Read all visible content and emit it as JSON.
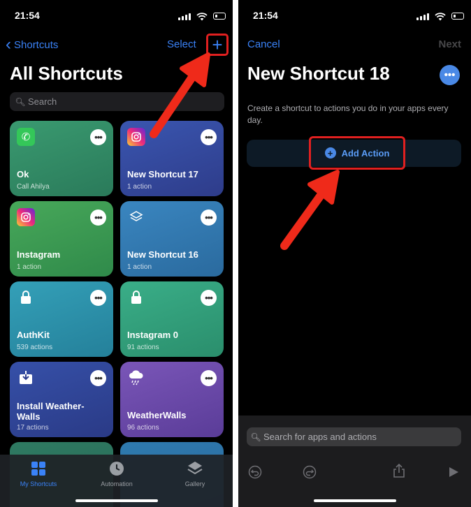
{
  "left_screen": {
    "status": {
      "time": "21:54"
    },
    "nav": {
      "back_label": "Shortcuts",
      "select_label": "Select",
      "add_label": "+"
    },
    "title": "All Shortcuts",
    "search_placeholder": "Search",
    "shortcuts": [
      {
        "title": "Ok",
        "subtitle": "Call Ahilya",
        "icon": "phone-icon",
        "color": "#2f8a65"
      },
      {
        "title": "New Shortcut 17",
        "subtitle": "1 action",
        "icon": "instagram-icon",
        "color": "#3a4a9c"
      },
      {
        "title": "Instagram",
        "subtitle": "1 action",
        "icon": "instagram-icon",
        "color": "#3f9a55"
      },
      {
        "title": "New Shortcut 16",
        "subtitle": "1 action",
        "icon": "layers-icon",
        "color": "#2f7aae"
      },
      {
        "title": "AuthKit",
        "subtitle": "539 actions",
        "icon": "lock-icon",
        "color": "#2b8faa"
      },
      {
        "title": "Instagram 0",
        "subtitle": "91 actions",
        "icon": "lock-icon",
        "color": "#35a07a"
      },
      {
        "title": "Install Weather-Walls",
        "subtitle": "17 actions",
        "icon": "download-icon",
        "color": "#2d3e8f"
      },
      {
        "title": "WeatherWalls",
        "subtitle": "96 actions",
        "icon": "cloud-rain-icon",
        "color": "#6a4aa8"
      }
    ],
    "tabs": [
      {
        "label": "My Shortcuts",
        "icon": "grid-icon",
        "active": true
      },
      {
        "label": "Automation",
        "icon": "clock-check-icon",
        "active": false
      },
      {
        "label": "Gallery",
        "icon": "layers-icon",
        "active": false
      }
    ]
  },
  "right_screen": {
    "status": {
      "time": "21:54"
    },
    "nav": {
      "cancel_label": "Cancel",
      "next_label": "Next"
    },
    "title": "New Shortcut 18",
    "description": "Create a shortcut to actions you do in your apps every day.",
    "add_action_label": "Add Action",
    "search_placeholder": "Search for apps and actions",
    "toolbar": [
      "undo-icon",
      "redo-icon",
      "share-icon",
      "play-icon"
    ]
  },
  "colors": {
    "accent": "#3a82f7",
    "highlight": "#e02020",
    "background": "#000000"
  }
}
